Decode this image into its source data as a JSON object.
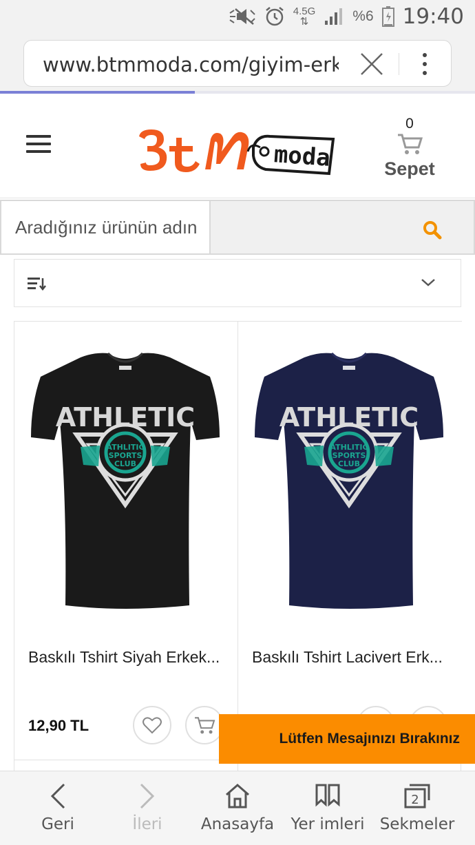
{
  "status_bar": {
    "battery_percent": "%6",
    "network": "4.5G",
    "time": "19:40"
  },
  "browser": {
    "url": "www.btmmoda.com/giyim-erkek",
    "load_progress": 0.41,
    "bottom_nav": [
      {
        "label": "Geri",
        "icon": "back-icon",
        "enabled": true
      },
      {
        "label": "İleri",
        "icon": "forward-icon",
        "enabled": false
      },
      {
        "label": "Anasayfa",
        "icon": "home-icon",
        "enabled": true
      },
      {
        "label": "Yer imleri",
        "icon": "bookmarks-icon",
        "enabled": true
      },
      {
        "label": "Sekmeler",
        "icon": "tabs-icon",
        "enabled": true
      }
    ],
    "tab_count": "2"
  },
  "site": {
    "logo_text": "BtM moda",
    "cart_count": "0",
    "cart_label": "Sepet",
    "search_placeholder": "Aradığınız ürünün adın",
    "accent": "#fb8c00",
    "logo_color": "#f05a1e"
  },
  "products": [
    {
      "name": "Baskılı Tshirt Siyah Erkek...",
      "price": "12,90 TL",
      "shirt_color": "#1a1a1a",
      "print_text": "ATHLETIC"
    },
    {
      "name": "Baskılı Tshirt Lacivert Erk...",
      "price": "",
      "shirt_color": "#1c2147",
      "print_text": "ATHLETIC"
    }
  ],
  "message_banner": "Lütfen Mesajınızı Bırakınız"
}
